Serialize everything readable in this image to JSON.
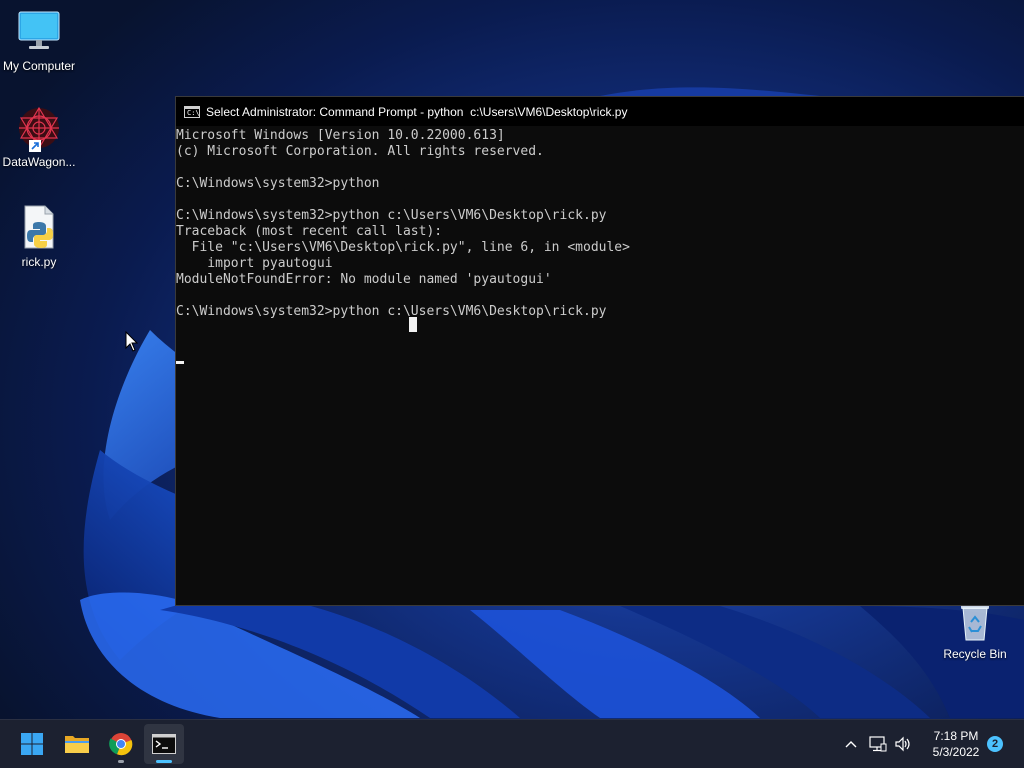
{
  "desktop": {
    "icons": [
      {
        "label": "My Computer",
        "icon": "monitor-icon"
      },
      {
        "label": "DataWagon...",
        "icon": "datawagon-app-icon"
      },
      {
        "label": "rick.py",
        "icon": "python-file-icon"
      },
      {
        "label": "Recycle Bin",
        "icon": "recycle-bin-icon"
      }
    ]
  },
  "console": {
    "icon_text": "C:\\",
    "title": "Select Administrator: Command Prompt - python  c:\\Users\\VM6\\Desktop\\rick.py",
    "lines": [
      "Microsoft Windows [Version 10.0.22000.613]",
      "(c) Microsoft Corporation. All rights reserved.",
      "",
      "C:\\Windows\\system32>python",
      "",
      "C:\\Windows\\system32>python c:\\Users\\VM6\\Desktop\\rick.py",
      "Traceback (most recent call last):",
      "  File \"c:\\Users\\VM6\\Desktop\\rick.py\", line 6, in <module>",
      "    import pyautogui",
      "ModuleNotFoundError: No module named 'pyautogui'",
      "",
      "C:\\Windows\\system32>python c:\\Users\\VM6\\Desktop\\rick.py"
    ]
  },
  "taskbar": {
    "items": [
      {
        "name": "start-button",
        "icon": "windows-logo-icon"
      },
      {
        "name": "file-explorer-button",
        "icon": "folder-icon"
      },
      {
        "name": "chrome-button",
        "icon": "chrome-icon"
      },
      {
        "name": "terminal-button",
        "icon": "terminal-icon"
      }
    ],
    "clock": {
      "time": "7:18 PM",
      "date": "5/3/2022"
    },
    "notification_count": "2"
  },
  "colors": {
    "console_bg": "#0c0c0c",
    "console_text": "#cccccc",
    "taskbar_bg": "#1c2130",
    "accent": "#4cc2ff"
  }
}
